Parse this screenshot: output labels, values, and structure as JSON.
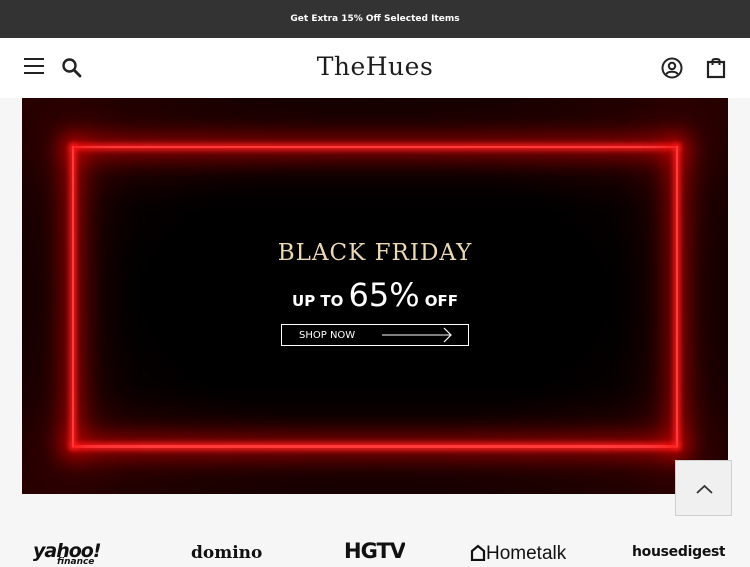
{
  "promo": {
    "text": "Get Extra 15% Off Selected Items"
  },
  "header": {
    "logo": "TheHues",
    "icons": {
      "menu": "hamburger-menu-icon",
      "search": "search-icon",
      "account": "account-icon",
      "cart": "shopping-bag-icon"
    }
  },
  "hero": {
    "title": "BLACK FRIDAY",
    "sub_prefix": "UP TO",
    "sub_value": "65%",
    "sub_suffix": "OFF",
    "button_label": "SHOP NOW",
    "neon_color": "#ff2a2a"
  },
  "back_to_top": {
    "icon": "chevron-up-icon"
  },
  "press": {
    "logos": [
      "yahoo!",
      "domino",
      "HGTV",
      "Hometalk",
      "housedigest"
    ],
    "yahoo_sub": "finance"
  }
}
